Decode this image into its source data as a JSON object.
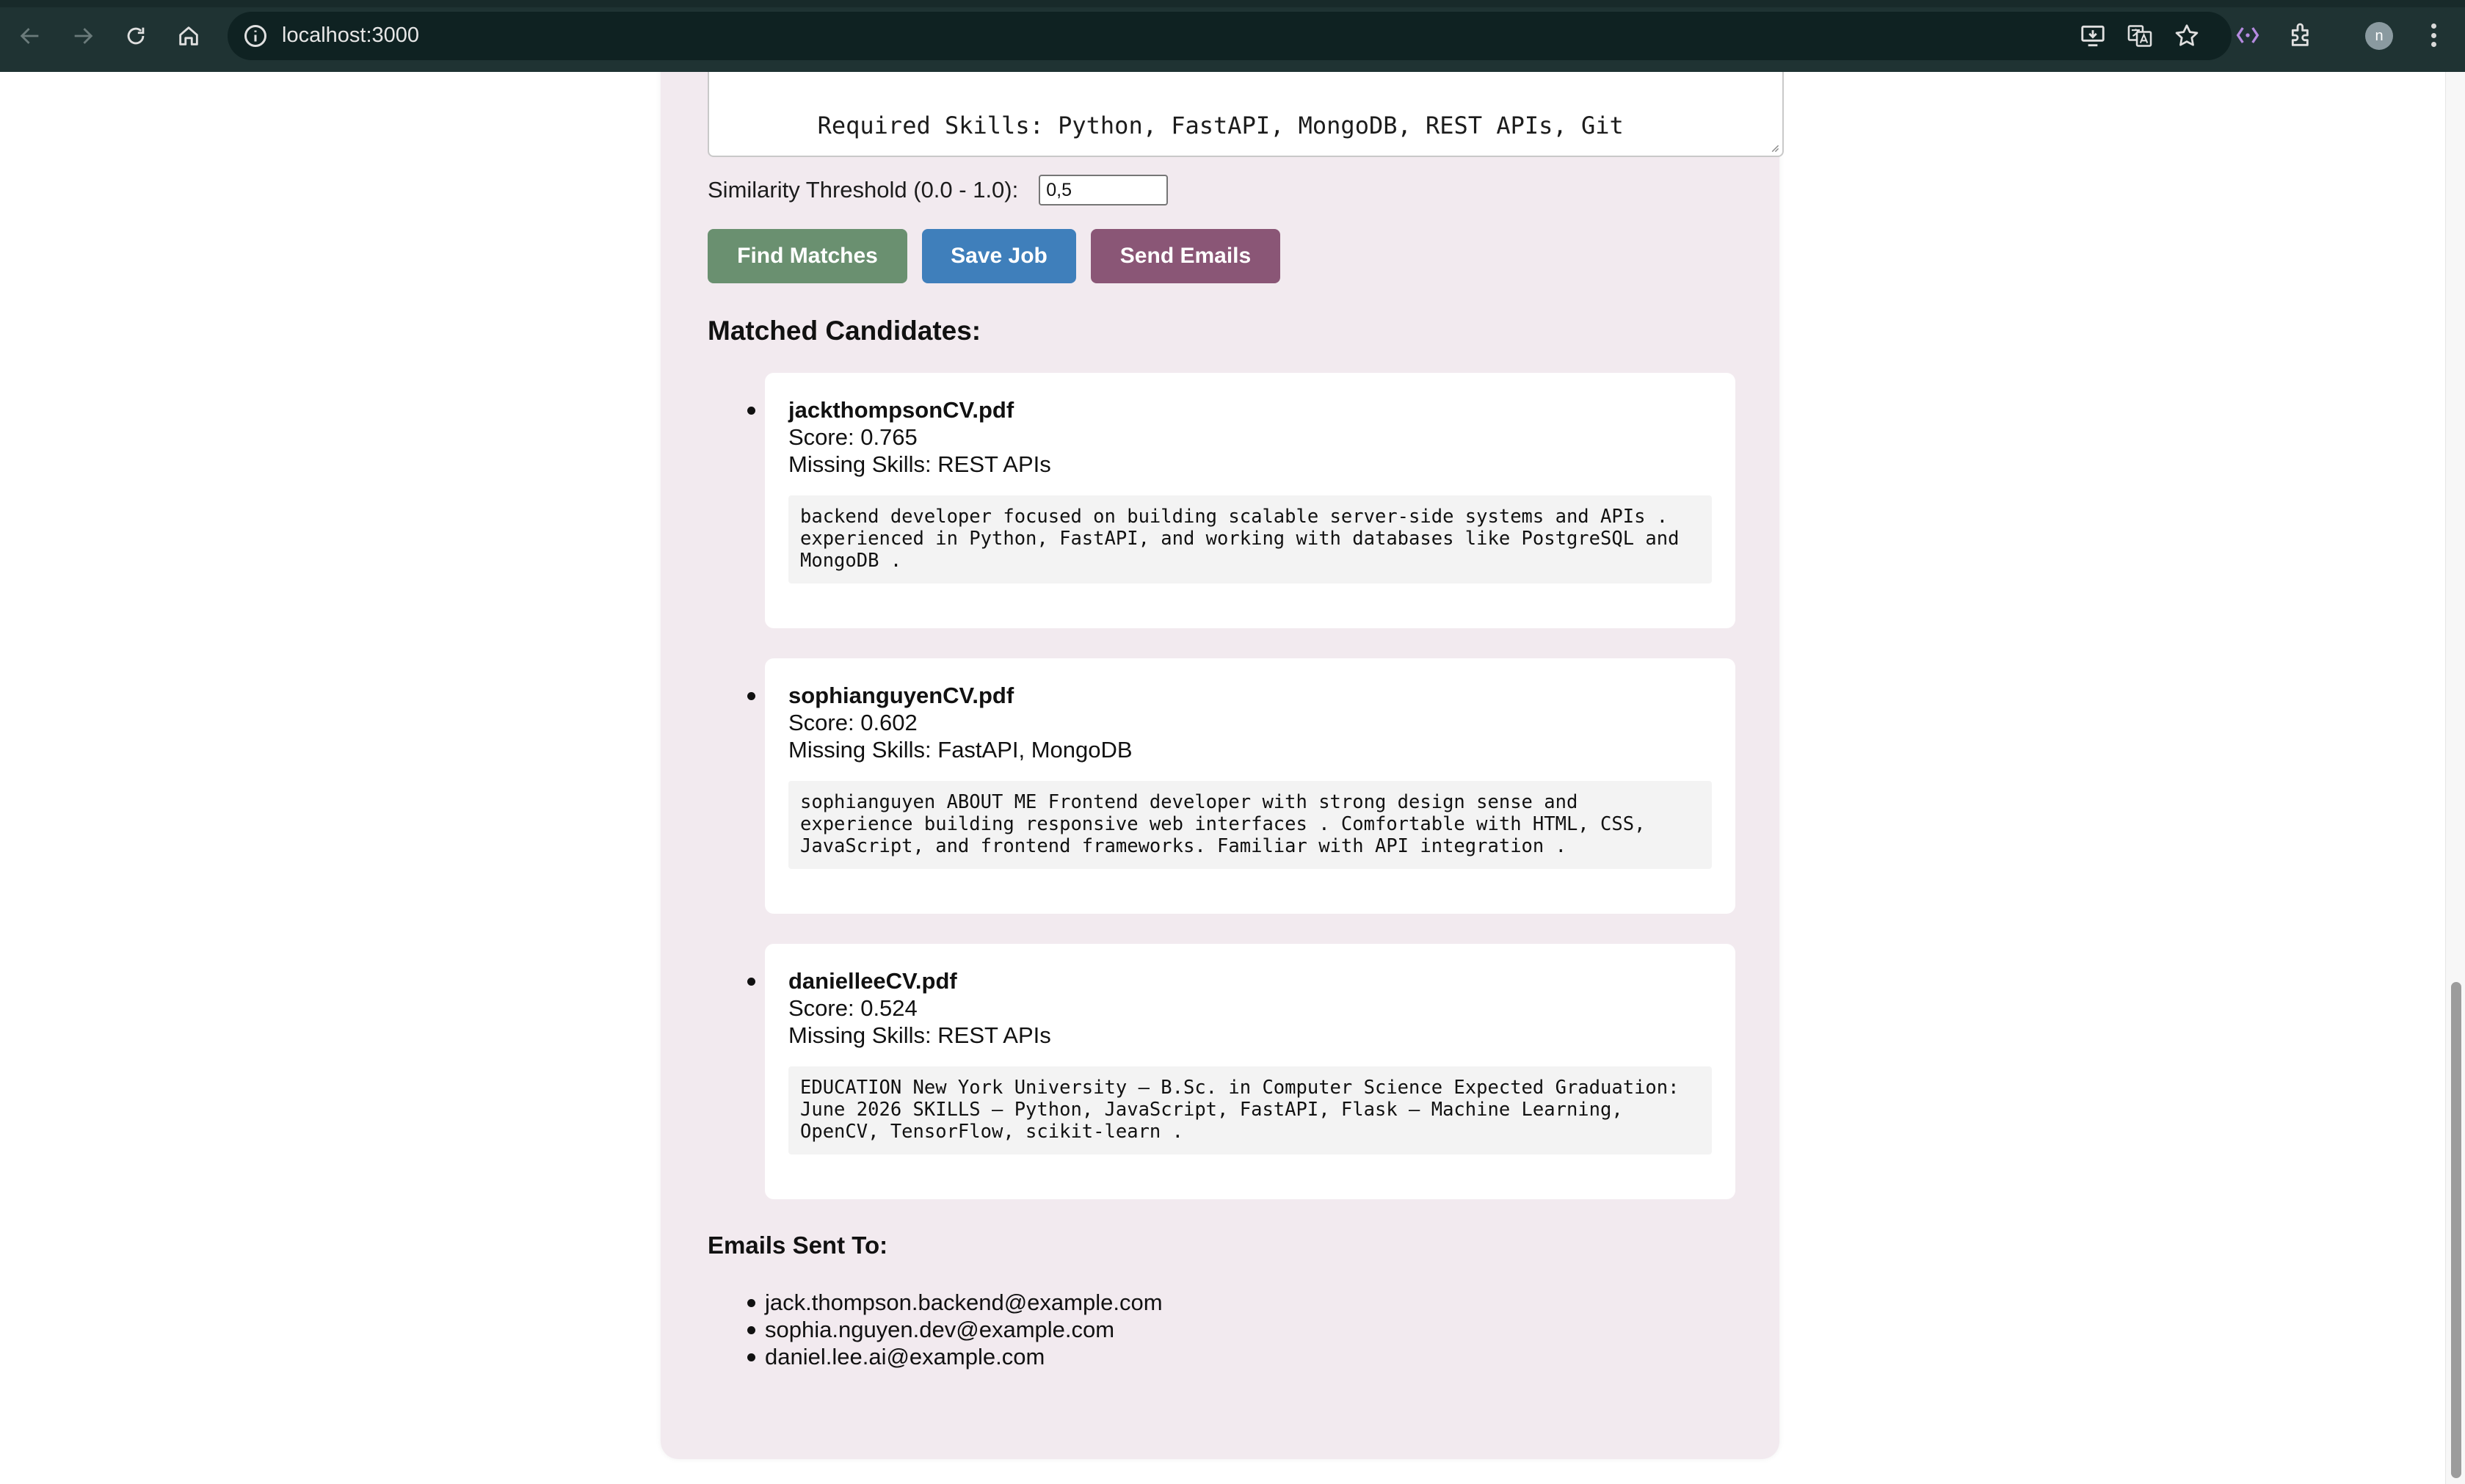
{
  "browser": {
    "url": "localhost:3000",
    "avatar_initial": "n"
  },
  "job": {
    "description_visible_line": "Required Skills: Python, FastAPI, MongoDB, REST APIs, Git",
    "threshold_label": "Similarity Threshold (0.0 - 1.0):",
    "threshold_value": "0,5"
  },
  "buttons": {
    "find_matches": "Find Matches",
    "save_job": "Save Job",
    "send_emails": "Send Emails"
  },
  "colors": {
    "find_matches": "#6a9070",
    "save_job": "#3f7fbb",
    "send_emails": "#8a5676",
    "card_background": "#f2eaef"
  },
  "matched": {
    "title": "Matched Candidates:",
    "candidates": [
      {
        "file": "jackthompsonCV.pdf",
        "score": "Score: 0.765",
        "missing": "Missing Skills: REST APIs",
        "excerpt": "backend developer focused on building scalable server-side systems and APIs .\nexperienced in Python, FastAPI, and working with databases like PostgreSQL and\nMongoDB ."
      },
      {
        "file": "sophianguyenCV.pdf",
        "score": "Score: 0.602",
        "missing": "Missing Skills: FastAPI, MongoDB",
        "excerpt": "sophianguyen ABOUT ME Frontend developer with strong design sense and\nexperience building responsive web interfaces . Comfortable with HTML, CSS,\nJavaScript, and frontend frameworks. Familiar with API integration ."
      },
      {
        "file": "danielleeCV.pdf",
        "score": "Score: 0.524",
        "missing": "Missing Skills: REST APIs",
        "excerpt": "EDUCATION New York University – B.Sc. in Computer Science Expected Graduation:\nJune 2026 SKILLS – Python, JavaScript, FastAPI, Flask – Machine Learning,\nOpenCV, TensorFlow, scikit-learn ."
      }
    ]
  },
  "emails": {
    "title": "Emails Sent To:",
    "list": [
      "jack.thompson.backend@example.com",
      "sophia.nguyen.dev@example.com",
      "daniel.lee.ai@example.com"
    ]
  }
}
